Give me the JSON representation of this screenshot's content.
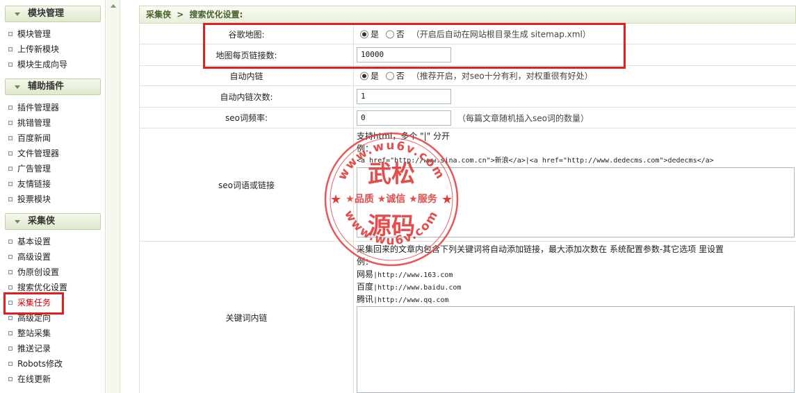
{
  "sidebar": {
    "sections": [
      {
        "title": "模块管理",
        "items": [
          "模块管理",
          "上传新模块",
          "模块生成向导"
        ]
      },
      {
        "title": "辅助插件",
        "items": [
          "插件管理器",
          "挑错管理",
          "百度新闻",
          "文件管理器",
          "广告管理",
          "友情链接",
          "投票模块"
        ]
      },
      {
        "title": "采集侠",
        "items": [
          "基本设置",
          "高级设置",
          "伪原创设置",
          "搜索优化设置",
          "采集任务",
          "高级定向",
          "整站采集",
          "推送记录",
          "Robots修改",
          "在线更新"
        ]
      }
    ],
    "active_item": "采集任务"
  },
  "breadcrumb": {
    "root": "采集侠",
    "sep": ">",
    "current": "搜索优化设置:"
  },
  "form": {
    "google_map": {
      "label": "谷歌地图:",
      "yes": "是",
      "no": "否",
      "selected": "是",
      "hint": "（开启后自动在网站根目录生成 sitemap.xml）"
    },
    "map_links": {
      "label": "地图每页链接数:",
      "value": "10000"
    },
    "auto_link": {
      "label": "自动内链",
      "yes": "是",
      "no": "否",
      "selected": "是",
      "hint": "（推荐开启，对seo十分有利，对权重很有好处）"
    },
    "auto_link_count": {
      "label": "自动内链次数:",
      "value": "1"
    },
    "seo_freq": {
      "label": "seo词频率:",
      "value": "0",
      "hint": "（每篇文章随机插入seo词的数量）"
    },
    "seo_words": {
      "label": "seo词语或链接",
      "note1": "支持html，多个 \"|\" 分开",
      "note2": "例：",
      "example": "<a href=\"http://www.sina.com.cn\">新浪</a>|<a href=\"http://www.dedecms.com\">dedecms</a>"
    },
    "keyword_links": {
      "label": "关键词内链",
      "note1": "采集回来的文章内包含下列关键词将自动添加链接，最大添加次数在 系统配置参数-其它选项 里设置",
      "note2": "例：",
      "ex1_name": "网易",
      "ex1_url": "|http://www.163.com",
      "ex2_name": "百度",
      "ex2_url": "|http://www.baidu.com",
      "ex3_name": "腾讯",
      "ex3_url": "|http://www.qq.com"
    }
  },
  "watermark": {
    "url_top": "www.wu6v.com",
    "url_bottom": "www.wu6v.com",
    "line1": "武松",
    "motto": "★品质 ★诚信 ★服务",
    "line2": "源码"
  },
  "colors": {
    "highlight": "#e0201c",
    "active_nav": "#d00000",
    "stamp": "#e33a3a"
  }
}
